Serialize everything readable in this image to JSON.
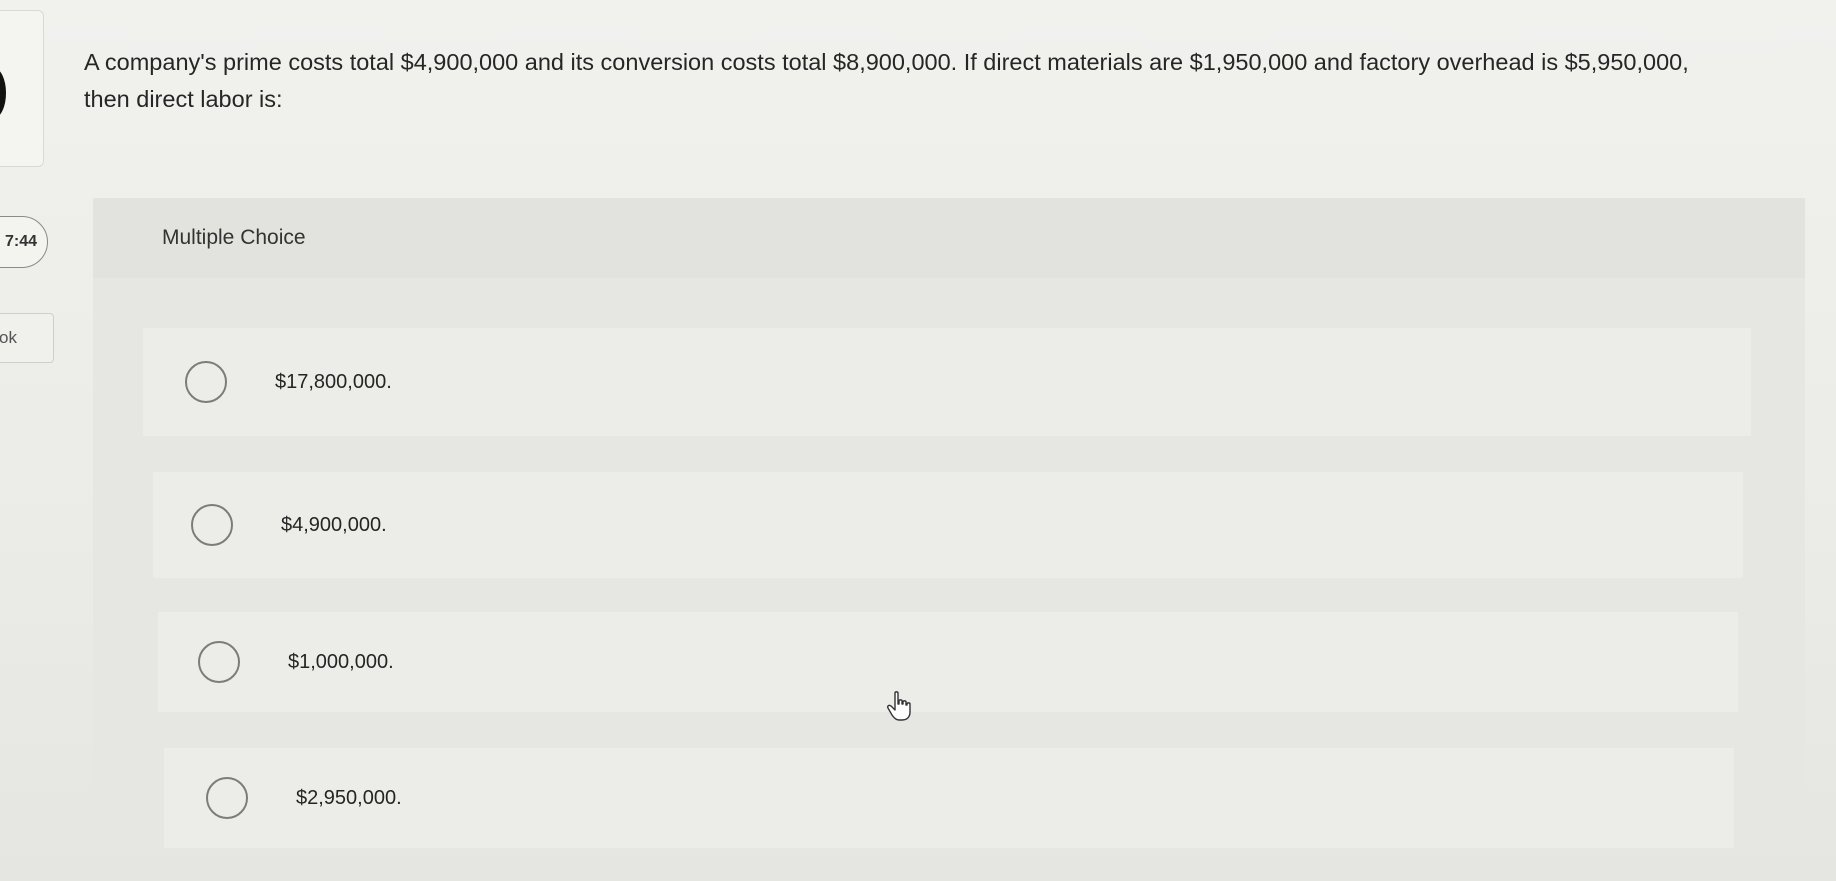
{
  "sidebar": {
    "timer": "7:44",
    "book_label": "ok"
  },
  "question": {
    "text": "A company's prime costs total $4,900,000 and its conversion costs total $8,900,000. If direct materials are $1,950,000 and factory overhead is $5,950,000, then direct labor is:"
  },
  "multiple_choice": {
    "label": "Multiple Choice",
    "options": [
      {
        "label": "$17,800,000."
      },
      {
        "label": "$4,900,000."
      },
      {
        "label": "$1,000,000."
      },
      {
        "label": "$2,950,000."
      }
    ]
  },
  "icons": {
    "cursor": "hand-pointer-icon",
    "radio": "radio-unchecked-icon"
  },
  "colors": {
    "background": "#eeeeea",
    "panel": "#e6e6e2",
    "radio_border": "#7c7c79"
  }
}
